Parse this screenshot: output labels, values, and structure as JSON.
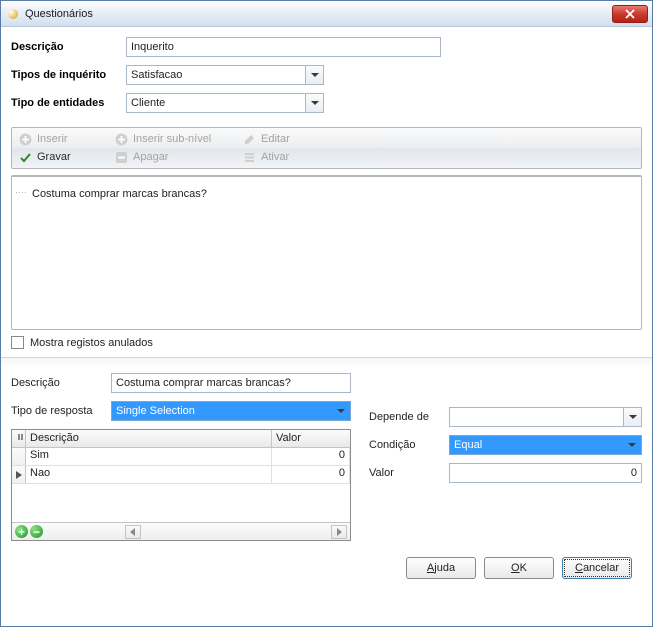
{
  "window": {
    "title": "Questionários"
  },
  "form": {
    "descricao_label": "Descrição",
    "descricao_value": "Inquerito",
    "tipos_inquerito_label": "Tipos de inquérito",
    "tipos_inquerito_value": "Satisfacao",
    "tipo_entidades_label": "Tipo de entidades",
    "tipo_entidades_value": "Cliente"
  },
  "toolbar": {
    "inserir": "Inserir",
    "inserir_sub": "Inserir sub-nível",
    "editar": "Editar",
    "gravar": "Gravar",
    "apagar": "Apagar",
    "ativar": "Ativar"
  },
  "tree": {
    "item0": "Costuma comprar marcas brancas?"
  },
  "mostra_anulados_label": "Mostra registos anulados",
  "detail": {
    "descricao_label": "Descrição",
    "descricao_value": "Costuma comprar marcas brancas?",
    "tipo_resposta_label": "Tipo de resposta",
    "tipo_resposta_value": "Single Selection",
    "depende_label": "Depende de",
    "depende_value": "",
    "condicao_label": "Condição",
    "condicao_value": "Equal",
    "valor_label": "Valor",
    "valor_value": "0"
  },
  "grid": {
    "col_descricao": "Descrição",
    "col_valor": "Valor",
    "rows": [
      {
        "desc": "Sim",
        "valor": "0"
      },
      {
        "desc": "Nao",
        "valor": "0"
      }
    ]
  },
  "buttons": {
    "ajuda": "Ajuda",
    "ok": "OK",
    "cancelar": "Cancelar"
  }
}
